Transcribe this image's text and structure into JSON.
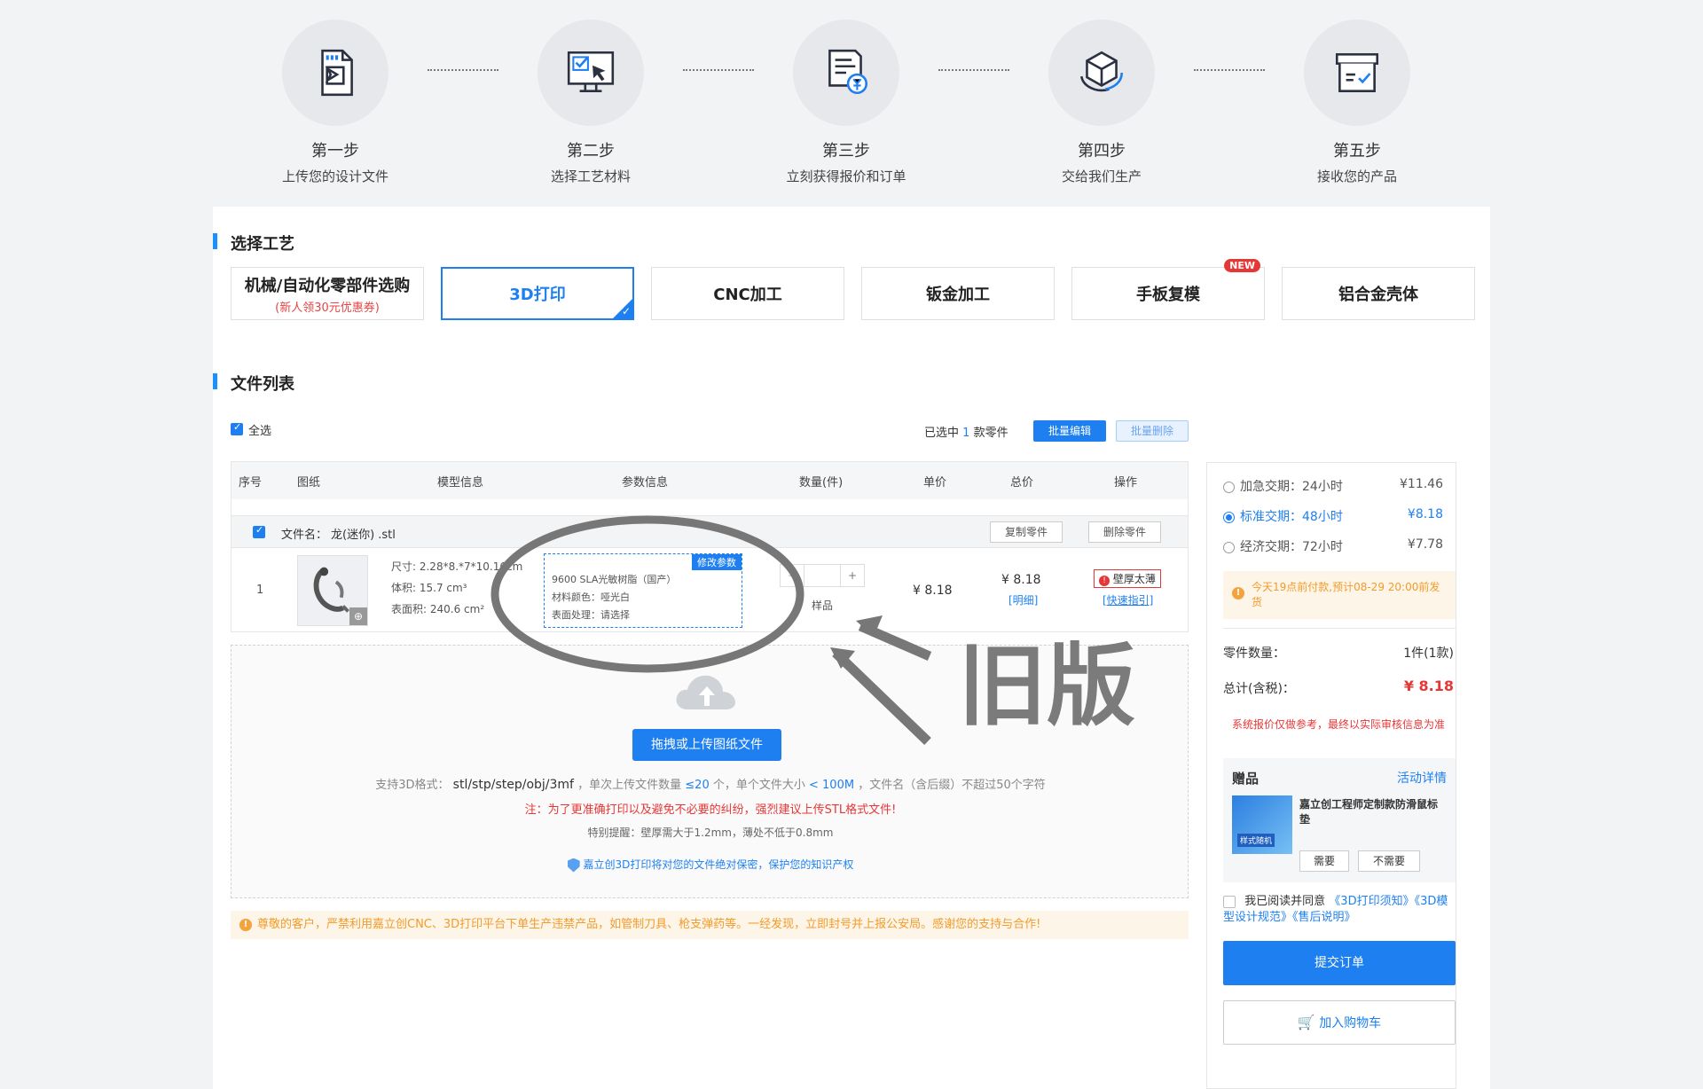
{
  "steps": [
    {
      "title": "第一步",
      "desc": "上传您的设计文件",
      "icon": "upload-file-icon"
    },
    {
      "title": "第二步",
      "desc": "选择工艺材料",
      "icon": "monitor-select-icon"
    },
    {
      "title": "第三步",
      "desc": "立刻获得报价和订单",
      "icon": "quote-document-icon"
    },
    {
      "title": "第四步",
      "desc": "交给我们生产",
      "icon": "cube-production-icon"
    },
    {
      "title": "第五步",
      "desc": "接收您的产品",
      "icon": "delivery-box-icon"
    }
  ],
  "section_process": "选择工艺",
  "processes": [
    {
      "label": "机械/自动化零部件选购",
      "sub": "(新人领30元优惠券)"
    },
    {
      "label": "3D打印",
      "active": true
    },
    {
      "label": "CNC加工"
    },
    {
      "label": "钣金加工"
    },
    {
      "label": "手板复模",
      "badge": "NEW"
    },
    {
      "label": "铝合金壳体"
    }
  ],
  "section_files": "文件列表",
  "toolbar": {
    "select_all": "全选",
    "selected_prefix": "已选中",
    "selected_count": "1",
    "selected_suffix": "款零件",
    "batch_edit": "批量编辑",
    "batch_delete": "批量删除"
  },
  "table": {
    "headers": [
      "序号",
      "图纸",
      "模型信息",
      "参数信息",
      "数量(件)",
      "单价",
      "总价",
      "操作"
    ],
    "file_label": "文件名：",
    "file_name": "龙(迷你) .stl",
    "copy_part": "复制零件",
    "delete_part": "删除零件",
    "row": {
      "index": "1",
      "size": "尺寸: 2.28*8.*7*10.16cm",
      "volume": "体积: 15.7 cm³",
      "area": "表面积: 240.6 cm²",
      "param_line1": "9600   SLA光敏树脂（国产）",
      "param_line2": "材料颜色：哑光白",
      "param_line3": "表面处理：请选择",
      "modify_params": "修改参数",
      "qty_label": "样品",
      "unit_price": "¥ 8.18",
      "total_price": "¥ 8.18",
      "detail": "[明细]",
      "warning_tag": "壁厚太薄",
      "quick_guide": "[快速指引]"
    }
  },
  "upload": {
    "button": "拖拽或上传图纸文件",
    "formats_label": "支持3D格式：",
    "formats": "stl/stp/step/obj/3mf",
    "count_text": "，单次上传文件数量",
    "count_limit": "≤20",
    "count_unit": "个，单个文件大小",
    "size_limit": "< 100M",
    "name_limit": "，文件名（含后缀）不超过50个字符",
    "note": "注：为了更准确打印以及避免不必要的纠纷，强烈建议上传STL格式文件!",
    "tip": "特别提醒：壁厚需大于1.2mm，薄处不低于0.8mm",
    "privacy": "嘉立创3D打印将对您的文件绝对保密，保护您的知识产权"
  },
  "warning": "尊敬的客户，严禁利用嘉立创CNC、3D打印平台下单生产违禁产品，如管制刀具、枪支弹药等。一经发现，立即封号并上报公安局。感谢您的支持与合作!",
  "delivery": [
    {
      "label": "加急交期：24小时",
      "price": "¥11.46",
      "selected": false
    },
    {
      "label": "标准交期：48小时",
      "price": "¥8.18",
      "selected": true
    },
    {
      "label": "经济交期：72小时",
      "price": "¥7.78",
      "selected": false
    }
  ],
  "delivery_note": "今天19点前付款,预计08-29 20:00前发货",
  "summary": {
    "parts_label": "零件数量：",
    "parts_value": "1件(1款)",
    "total_label": "总计(含税)：",
    "total_value": "¥ 8.18",
    "disclaimer": "系统报价仅做参考，最终以实际审核信息为准"
  },
  "gift": {
    "title": "赠品",
    "link": "活动详情",
    "name": "嘉立创工程师定制款防滑鼠标垫",
    "img_label": "样式随机",
    "need": "需要",
    "no_need": "不需要"
  },
  "agree": {
    "prefix": "我已阅读并同意",
    "links": "《3D打印须知》《3D模型设计规范》《售后说明》"
  },
  "submit": "提交订单",
  "cart": "加入购物车",
  "annotation": "旧版",
  "colors": {
    "accent": "#1e80f0",
    "danger": "#e63737",
    "warning": "#f39b2b"
  }
}
